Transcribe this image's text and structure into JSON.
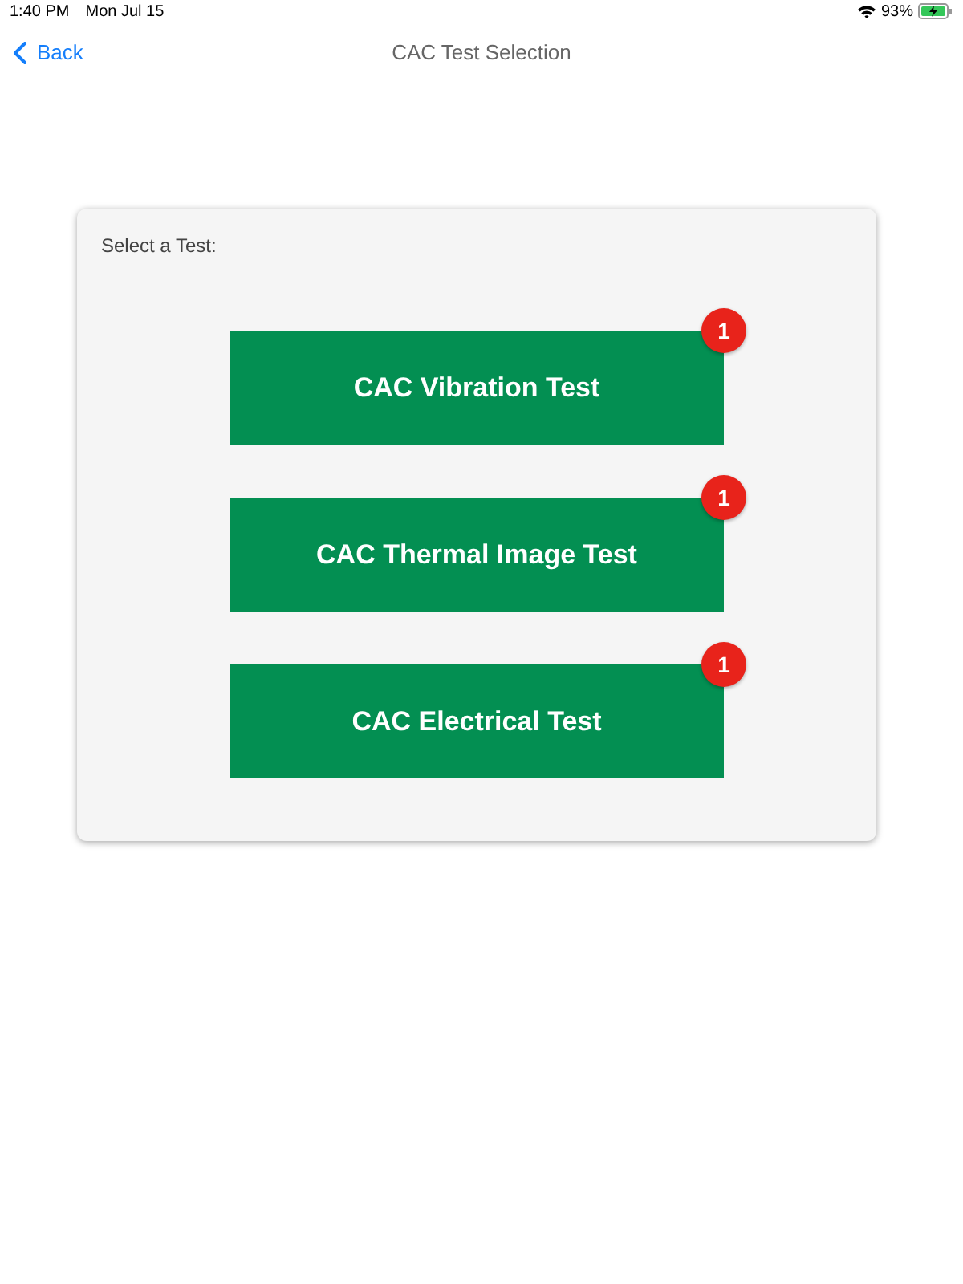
{
  "status_bar": {
    "time": "1:40 PM",
    "date": "Mon Jul 15",
    "battery": "93%"
  },
  "nav": {
    "back": "Back",
    "title": "CAC Test Selection"
  },
  "card": {
    "label": "Select a Test:",
    "tests": [
      {
        "label": "CAC Vibration Test",
        "badge": "1"
      },
      {
        "label": "CAC Thermal Image Test",
        "badge": "1"
      },
      {
        "label": "CAC Electrical Test",
        "badge": "1"
      }
    ]
  }
}
